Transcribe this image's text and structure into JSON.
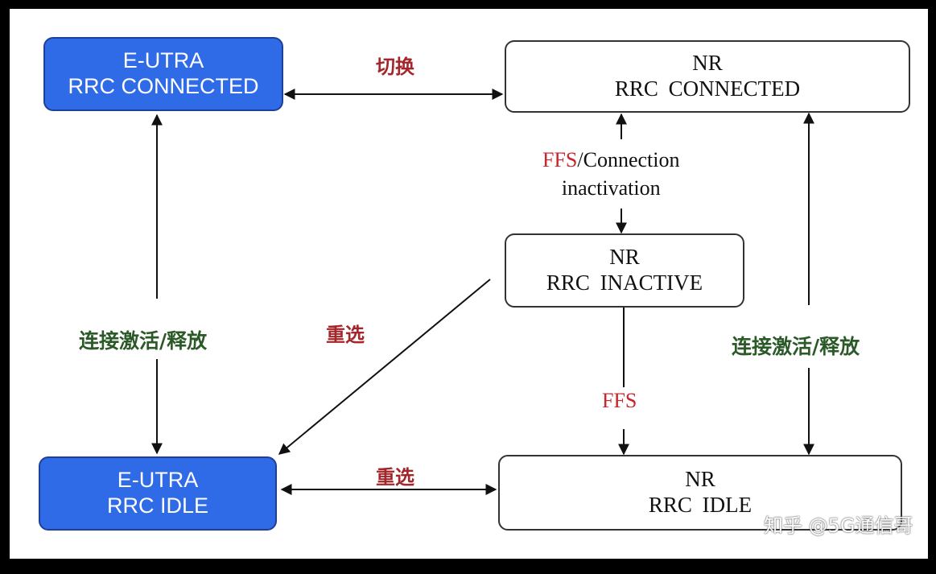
{
  "nodes": {
    "eutra_connected": {
      "line1": "E-UTRA",
      "line2": "RRC CONNECTED"
    },
    "eutra_idle": {
      "line1": "E-UTRA",
      "line2": "RRC IDLE"
    },
    "nr_connected": {
      "line1": "NR",
      "line2": "RRC CONNECTED"
    },
    "nr_inactive": {
      "line1": "NR",
      "line2": "RRC INACTIVE"
    },
    "nr_idle": {
      "line1": "NR",
      "line2": "RRC IDLE"
    }
  },
  "edges": {
    "handover": "切换",
    "reselect_diag": "重选",
    "reselect_bottom": "重选",
    "conn_release_left": "连接激活/释放",
    "conn_release_right": "连接激活/释放",
    "ffs_connection_prefix": "FFS",
    "ffs_connection_rest": "/Connection",
    "ffs_connection_line2": "inactivation",
    "ffs_idle": "FFS"
  },
  "watermark": "知乎 @5G通信哥",
  "colors": {
    "blue_box": "#2f6be6",
    "red_label": "#a3262b",
    "green_label": "#2b5a28",
    "ffs_red": "#c8262c"
  }
}
